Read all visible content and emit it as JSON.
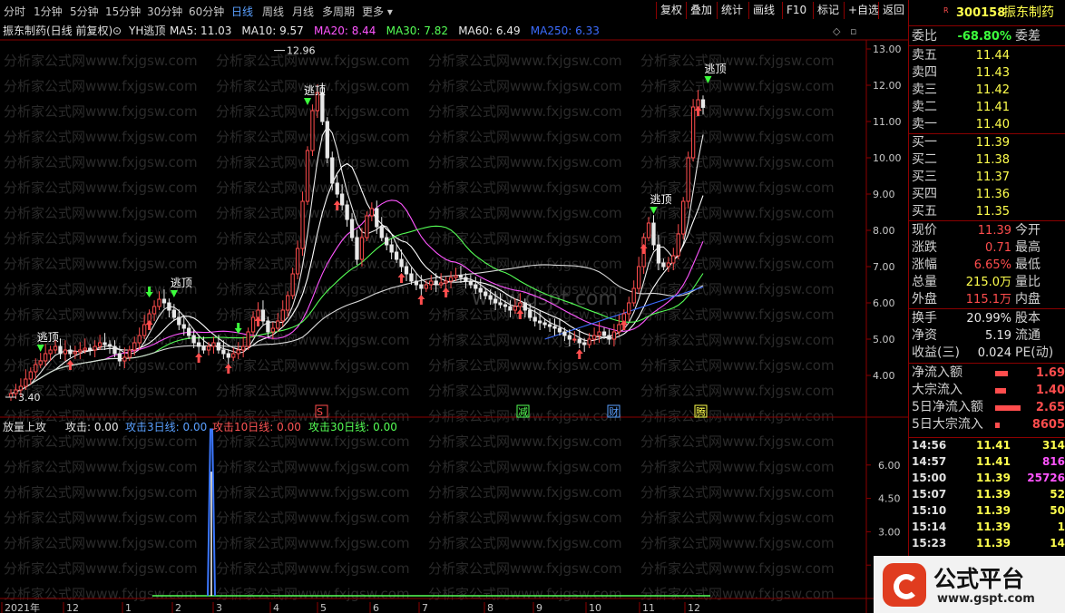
{
  "toolbar": {
    "periods": [
      "分时",
      "1分钟",
      "5分钟",
      "15分钟",
      "30分钟",
      "60分钟",
      "日线",
      "周线",
      "月线",
      "多周期",
      "更多"
    ],
    "active_period": "日线",
    "buttons": [
      "复权",
      "叠加",
      "统计",
      "画线",
      "F10",
      "标记",
      "+自选",
      "返回"
    ]
  },
  "chart": {
    "title": "振东制药(日线 前复权)",
    "indicator_name": "YH逃顶",
    "ma": [
      {
        "label": "MA5:",
        "value": "11.03",
        "color": "#e8e8e8"
      },
      {
        "label": "MA10:",
        "value": "9.57",
        "color": "#e8e8e8"
      },
      {
        "label": "MA20:",
        "value": "8.44",
        "color": "#ff55ff"
      },
      {
        "label": "MA30:",
        "value": "7.82",
        "color": "#55ff55"
      },
      {
        "label": "MA60:",
        "value": "6.49",
        "color": "#e8e8e8"
      },
      {
        "label": "MA250:",
        "value": "6.33",
        "color": "#3c6cff"
      }
    ],
    "high_label": "12.96",
    "low_label": "3.40",
    "escape_label": "逃顶",
    "watermark_text": "分析家公式网www.fxjgsw.com",
    "watermark_center": "www.gspt.com",
    "event_markers": [
      "S",
      "减",
      "财",
      "腾"
    ],
    "price_axis": [
      "13.00",
      "12.00",
      "11.00",
      "10.00",
      "9.00",
      "8.00",
      "7.00",
      "6.00",
      "5.00",
      "4.00"
    ],
    "vol_axis": [
      "6.00",
      "4.50",
      "3.00",
      "1.50"
    ],
    "months": [
      "2021年",
      "12",
      "1",
      "2",
      "3",
      "4",
      "5",
      "6",
      "7",
      "8",
      "9",
      "10",
      "11",
      "12"
    ],
    "sub_indicator": {
      "name": "放量上攻",
      "items": [
        {
          "label": "攻击:",
          "value": "0.00",
          "color": "#e8e8e8"
        },
        {
          "label": "攻击3日线:",
          "value": "0.00",
          "color": "#5aa0ff"
        },
        {
          "label": "攻击10日线:",
          "value": "0.00",
          "color": "#ff5555"
        },
        {
          "label": "攻击30日线:",
          "value": "0.00",
          "color": "#55ff55"
        }
      ]
    }
  },
  "chart_data": {
    "type": "candlestick",
    "ylim": [
      3.0,
      13.2
    ],
    "closes": [
      3.5,
      3.6,
      3.7,
      3.9,
      4.1,
      4.3,
      4.4,
      4.6,
      4.7,
      4.8,
      4.6,
      4.7,
      4.6,
      4.65,
      4.7,
      4.75,
      4.7,
      4.8,
      4.9,
      4.85,
      4.8,
      4.6,
      4.4,
      4.5,
      4.7,
      4.9,
      5.1,
      5.4,
      5.7,
      5.9,
      6.1,
      6.0,
      5.8,
      5.6,
      5.4,
      5.3,
      5.1,
      4.9,
      4.8,
      4.7,
      4.8,
      4.9,
      4.7,
      4.6,
      4.5,
      4.6,
      4.7,
      4.8,
      5.2,
      5.6,
      5.8,
      5.5,
      5.2,
      5.3,
      5.5,
      5.8,
      6.2,
      6.8,
      7.5,
      8.8,
      10.2,
      11.3,
      11.8,
      11.0,
      10.0,
      9.3,
      9.0,
      8.7,
      8.3,
      7.8,
      7.2,
      7.8,
      8.4,
      8.6,
      8.1,
      7.8,
      7.6,
      7.4,
      7.2,
      7.0,
      6.8,
      6.6,
      6.5,
      6.4,
      6.5,
      6.6,
      6.5,
      6.55,
      6.6,
      6.7,
      6.75,
      6.7,
      6.6,
      6.5,
      6.4,
      6.3,
      6.2,
      6.1,
      6.0,
      5.95,
      5.9,
      5.8,
      5.9,
      6.0,
      5.8,
      5.6,
      5.5,
      5.45,
      5.4,
      5.35,
      5.3,
      5.2,
      5.1,
      5.0,
      5.0,
      4.9,
      4.85,
      5.0,
      5.1,
      5.2,
      5.1,
      5.0,
      5.2,
      5.4,
      5.7,
      6.0,
      6.4,
      7.0,
      7.8,
      8.2,
      7.6,
      7.1,
      7.0,
      7.1,
      7.3,
      7.9,
      8.8,
      10.0,
      11.4,
      11.6,
      11.39
    ],
    "escape_points": [
      {
        "i": 6,
        "price": 4.7
      },
      {
        "i": 33,
        "price": 6.2
      },
      {
        "i": 60,
        "price": 11.5
      },
      {
        "i": 130,
        "price": 8.5
      },
      {
        "i": 141,
        "price": 12.1
      }
    ],
    "buy_arrows": [
      12,
      28,
      38,
      44,
      50,
      66,
      79,
      83,
      88,
      103,
      115,
      124,
      128,
      139
    ],
    "green_down_arrows": [
      28,
      46
    ],
    "attack_spike": {
      "month_index": 2,
      "value": 7.6
    },
    "vol_ylim": [
      0,
      7.5
    ]
  },
  "quote": {
    "code": "300158",
    "name": "振东制药",
    "wb_label": "委比",
    "wb_value": "-68.80%",
    "wc_label": "委差",
    "sell": [
      {
        "label": "卖五",
        "price": "11.44"
      },
      {
        "label": "卖四",
        "price": "11.43"
      },
      {
        "label": "卖三",
        "price": "11.42"
      },
      {
        "label": "卖二",
        "price": "11.41"
      },
      {
        "label": "卖一",
        "price": "11.40"
      }
    ],
    "buy": [
      {
        "label": "买一",
        "price": "11.39"
      },
      {
        "label": "买二",
        "price": "11.38"
      },
      {
        "label": "买三",
        "price": "11.37"
      },
      {
        "label": "买四",
        "price": "11.36"
      },
      {
        "label": "买五",
        "price": "11.35"
      }
    ],
    "stats": [
      {
        "label": "现价",
        "value": "11.39",
        "right": "今开",
        "cls": "red"
      },
      {
        "label": "涨跌",
        "value": "0.71",
        "right": "最高",
        "cls": "red"
      },
      {
        "label": "涨幅",
        "value": "6.65%",
        "right": "最低",
        "cls": "red"
      },
      {
        "label": "总量",
        "value": "215.0万",
        "right": "量比",
        "cls": "yellow"
      },
      {
        "label": "外盘",
        "value": "115.1万",
        "right": "内盘",
        "cls": "red"
      }
    ],
    "stats2": [
      {
        "label": "换手",
        "value": "20.99%",
        "right": "股本"
      },
      {
        "label": "净资",
        "value": "5.19",
        "right": "流通"
      },
      {
        "label": "收益(三)",
        "value": "0.024",
        "right": "PE(动)"
      }
    ],
    "flows": [
      {
        "label": "净流入额",
        "value": "1.69",
        "bar": 14
      },
      {
        "label": "大宗流入",
        "value": "1.40",
        "bar": 12
      },
      {
        "label": "5日净流入额",
        "value": "2.65",
        "bar": 28
      },
      {
        "label": "5日大宗流入",
        "value": "8605",
        "bar": 5
      }
    ],
    "ticks": [
      {
        "time": "14:56",
        "price": "11.41",
        "vol": "314",
        "cls": "yellow"
      },
      {
        "time": "14:57",
        "price": "11.41",
        "vol": "816",
        "cls": "pink"
      },
      {
        "time": "15:00",
        "price": "11.39",
        "vol": "25726",
        "cls": "pink"
      },
      {
        "time": "15:07",
        "price": "11.39",
        "vol": "52",
        "cls": "yellow"
      },
      {
        "time": "15:10",
        "price": "11.39",
        "vol": "50",
        "cls": "yellow"
      },
      {
        "time": "15:14",
        "price": "11.39",
        "vol": "1",
        "cls": "yellow"
      },
      {
        "time": "15:23",
        "price": "11.39",
        "vol": "14",
        "cls": "yellow"
      }
    ]
  },
  "badge": {
    "title": "公式平台",
    "url": "www.gspt.com"
  }
}
